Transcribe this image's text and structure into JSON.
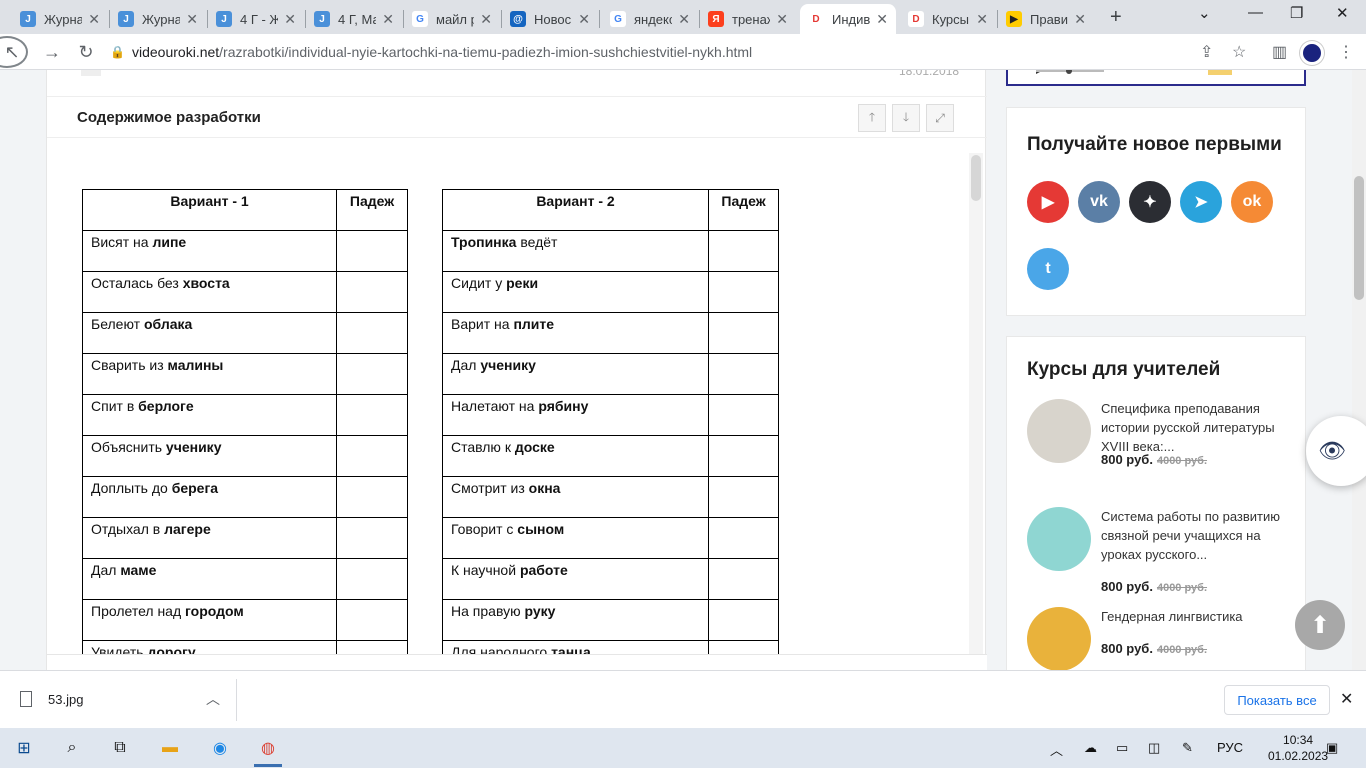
{
  "browser": {
    "tabs": [
      {
        "title": "Журнал",
        "icon_color": "#4a90d9",
        "icon": "J"
      },
      {
        "title": "Журнал",
        "icon_color": "#4a90d9",
        "icon": "J"
      },
      {
        "title": "4 Г - Ж",
        "icon_color": "#4a90d9",
        "icon": "J"
      },
      {
        "title": "4 Г, Ма",
        "icon_color": "#4a90d9",
        "icon": "J"
      },
      {
        "title": "майл р",
        "icon_color": "#ffffff",
        "icon": "G"
      },
      {
        "title": "Новос",
        "icon_color": "#1565c0",
        "icon": "@"
      },
      {
        "title": "яндекс",
        "icon_color": "#ffffff",
        "icon": "G"
      },
      {
        "title": "тренаж",
        "icon_color": "#fc3f1d",
        "icon": "Я"
      },
      {
        "title": "Индив",
        "icon_color": "#ffffff",
        "icon": "D"
      },
      {
        "title": "Курсы",
        "icon_color": "#ffffff",
        "icon": "D"
      },
      {
        "title": "Прави",
        "icon_color": "#ffcc00",
        "icon": "▶"
      }
    ],
    "active_tab": 8,
    "close_glyph": "✕",
    "new_tab": "+",
    "url_host": "videouroki.net",
    "url_path": "/razrabotki/individual-nyie-kartochki-na-tiemu-padiezh-imion-sushchiestvitiel-nykh.html"
  },
  "page": {
    "date_partial": "18.01.2018",
    "content_title": "Содержимое разработки",
    "table1": {
      "header": [
        "Вариант - 1",
        "Падеж"
      ],
      "rows": [
        {
          "pre": "Висят на ",
          "bold": "липе",
          "post": ""
        },
        {
          "pre": "Осталась без ",
          "bold": "хвоста",
          "post": ""
        },
        {
          "pre": "Белеют ",
          "bold": "облака",
          "post": ""
        },
        {
          "pre": "Сварить из ",
          "bold": "малины",
          "post": ""
        },
        {
          "pre": "Спит в ",
          "bold": "берлоге",
          "post": ""
        },
        {
          "pre": "Объяснить ",
          "bold": "ученику",
          "post": ""
        },
        {
          "pre": "Доплыть до ",
          "bold": "берега",
          "post": ""
        },
        {
          "pre": "Отдыхал в ",
          "bold": "лагере",
          "post": ""
        },
        {
          "pre": "Дал ",
          "bold": "маме",
          "post": ""
        },
        {
          "pre": "Пролетел над ",
          "bold": "городом",
          "post": ""
        },
        {
          "pre": "Увидеть ",
          "bold": "дорогу",
          "post": ""
        }
      ]
    },
    "table2": {
      "header": [
        "Вариант - 2",
        "Падеж"
      ],
      "rows": [
        {
          "pre": "",
          "bold": "Тропинка",
          "post": " ведёт"
        },
        {
          "pre": "Сидит у ",
          "bold": "реки",
          "post": ""
        },
        {
          "pre": "Варит на ",
          "bold": "плите",
          "post": ""
        },
        {
          "pre": "Дал ",
          "bold": "ученику",
          "post": ""
        },
        {
          "pre": "Налетают на ",
          "bold": "рябину",
          "post": ""
        },
        {
          "pre": "Ставлю к ",
          "bold": "доске",
          "post": ""
        },
        {
          "pre": "Смотрит из ",
          "bold": "окна",
          "post": ""
        },
        {
          "pre": "Говорит с ",
          "bold": "сыном",
          "post": ""
        },
        {
          "pre": "К научной ",
          "bold": "работе",
          "post": ""
        },
        {
          "pre": "На правую ",
          "bold": "руку",
          "post": ""
        },
        {
          "pre": "Для народного ",
          "bold": "танца",
          "post": ""
        }
      ]
    }
  },
  "sidebar": {
    "social_title": "Получайте новое первыми",
    "social": [
      {
        "name": "youtube",
        "color": "#e53935",
        "glyph": "▶"
      },
      {
        "name": "vk",
        "color": "#5b7fa6",
        "glyph": "vk"
      },
      {
        "name": "dzen",
        "color": "#2b2d33",
        "glyph": "✦"
      },
      {
        "name": "telegram",
        "color": "#2aa3dc",
        "glyph": "➤"
      },
      {
        "name": "odnoklassniki",
        "color": "#f58a35",
        "glyph": "ok"
      },
      {
        "name": "twitter",
        "color": "#4aa6e8",
        "glyph": "t"
      }
    ],
    "courses_title": "Курсы для учителей",
    "courses": [
      {
        "title": "Специфика преподавания истории русской литературы XVIII века:...",
        "price": "800 руб.",
        "old_price": "4000 руб.",
        "thumb_color": "#d8d4cc"
      },
      {
        "title": "Система работы по развитию связной речи учащихся на уроках русского...",
        "price": "800 руб.",
        "old_price": "4000 руб.",
        "thumb_color": "#8fd6d2"
      },
      {
        "title": "Гендерная лингвистика",
        "price": "800 руб.",
        "old_price": "4000 руб.",
        "thumb_color": "#e9b23b"
      }
    ]
  },
  "downloads": {
    "file": "53.jpg",
    "show_all": "Показать все"
  },
  "taskbar": {
    "lang": "РУС",
    "time": "10:34",
    "date": "01.02.2023"
  }
}
